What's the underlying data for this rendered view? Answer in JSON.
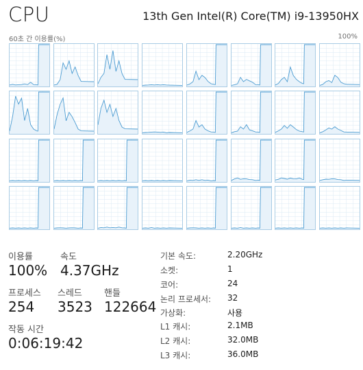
{
  "header": {
    "title": "CPU",
    "cpu_model": "13th Gen Intel(R) Core(TM) i9-13950HX"
  },
  "graph": {
    "y_label": "60초 간 이용률(%)",
    "y_max_label": "100%",
    "line_color": "#4a9bd1",
    "fill_color": "#e8f2fa",
    "border_color": "#a8cbe4",
    "gridline_color": "#dbe9f4",
    "rows": 4,
    "columns": 8,
    "cores": [
      {
        "spike": 1,
        "act": [
          2,
          3,
          2,
          2,
          3,
          4,
          3,
          8,
          3,
          2
        ]
      },
      {
        "spike": 0,
        "act": [
          2,
          3,
          15,
          55,
          40,
          60,
          30,
          45,
          25,
          10
        ]
      },
      {
        "spike": 0,
        "act": [
          5,
          20,
          30,
          75,
          40,
          85,
          35,
          60,
          30,
          15
        ]
      },
      {
        "spike": 0,
        "act": [
          1,
          1,
          2,
          2,
          2,
          2,
          2,
          2,
          2,
          1
        ]
      },
      {
        "spike": 1,
        "act": [
          2,
          4,
          10,
          35,
          15,
          25,
          20,
          10,
          5,
          3
        ]
      },
      {
        "spike": 1,
        "act": [
          1,
          2,
          5,
          20,
          10,
          15,
          12,
          8,
          3,
          2
        ]
      },
      {
        "spike": 1,
        "act": [
          2,
          5,
          15,
          20,
          10,
          45,
          25,
          15,
          10,
          5
        ]
      },
      {
        "spike": 0,
        "act": [
          1,
          3,
          10,
          12,
          8,
          25,
          20,
          8,
          5,
          3
        ]
      },
      {
        "spike": 1,
        "act": [
          5,
          40,
          90,
          70,
          85,
          30,
          60,
          20,
          10,
          5
        ]
      },
      {
        "spike": 0,
        "act": [
          10,
          45,
          70,
          85,
          30,
          50,
          40,
          25,
          10,
          5
        ]
      },
      {
        "spike": 0,
        "act": [
          20,
          60,
          80,
          50,
          70,
          40,
          60,
          30,
          15,
          10
        ]
      },
      {
        "spike": 0,
        "act": [
          1,
          1,
          2,
          2,
          3,
          2,
          2,
          2,
          1,
          1
        ]
      },
      {
        "spike": 1,
        "act": [
          2,
          5,
          10,
          30,
          15,
          20,
          10,
          5,
          3,
          2
        ]
      },
      {
        "spike": 1,
        "act": [
          1,
          3,
          5,
          15,
          10,
          20,
          8,
          5,
          3,
          2
        ]
      },
      {
        "spike": 1,
        "act": [
          2,
          5,
          10,
          18,
          12,
          20,
          15,
          8,
          5,
          3
        ]
      },
      {
        "spike": 0,
        "act": [
          1,
          3,
          8,
          12,
          10,
          15,
          10,
          6,
          3,
          2
        ]
      },
      {
        "spike": 1,
        "act": [
          1,
          1,
          1,
          1,
          1,
          1,
          1,
          1,
          1,
          1
        ]
      },
      {
        "spike": 1,
        "act": [
          1,
          1,
          1,
          1,
          1,
          1,
          1,
          1,
          1,
          1
        ]
      },
      {
        "spike": 1,
        "act": [
          1,
          1,
          1,
          1,
          1,
          1,
          1,
          1,
          1,
          1
        ]
      },
      {
        "spike": 0,
        "act": [
          1,
          1,
          1,
          1,
          1,
          1,
          1,
          1,
          1,
          1
        ]
      },
      {
        "spike": 1,
        "act": [
          1,
          2,
          2,
          3,
          2,
          3,
          2,
          2,
          1,
          1
        ]
      },
      {
        "spike": 1,
        "act": [
          2,
          5,
          8,
          4,
          6,
          5,
          4,
          3,
          2,
          2
        ]
      },
      {
        "spike": 1,
        "act": [
          3,
          4,
          8,
          6,
          5,
          7,
          6,
          5,
          8,
          4
        ]
      },
      {
        "spike": 0,
        "act": [
          2,
          3,
          5,
          4,
          6,
          5,
          4,
          3,
          2,
          2
        ]
      },
      {
        "spike": 1,
        "act": [
          1,
          1,
          1,
          1,
          1,
          1,
          1,
          1,
          1,
          1
        ]
      },
      {
        "spike": 1,
        "act": [
          1,
          1,
          2,
          1,
          1,
          1,
          2,
          1,
          1,
          1
        ]
      },
      {
        "spike": 1,
        "act": [
          1,
          2,
          2,
          3,
          2,
          2,
          2,
          3,
          2,
          1
        ]
      },
      {
        "spike": 0,
        "act": [
          1,
          1,
          1,
          2,
          1,
          1,
          1,
          1,
          1,
          1
        ]
      },
      {
        "spike": 1,
        "act": [
          1,
          1,
          2,
          1,
          1,
          1,
          1,
          1,
          1,
          1
        ]
      },
      {
        "spike": 1,
        "act": [
          1,
          1,
          1,
          2,
          1,
          1,
          1,
          1,
          1,
          1
        ]
      },
      {
        "spike": 1,
        "act": [
          1,
          1,
          1,
          1,
          1,
          1,
          1,
          1,
          1,
          1
        ]
      },
      {
        "spike": 0,
        "act": [
          1,
          1,
          1,
          1,
          1,
          1,
          1,
          1,
          1,
          1
        ]
      }
    ]
  },
  "stats": {
    "utilization_label": "이용률",
    "utilization_value": "100%",
    "speed_label": "속도",
    "speed_value": "4.37GHz",
    "processes_label": "프로세스",
    "processes_value": "254",
    "threads_label": "스레드",
    "threads_value": "3523",
    "handles_label": "핸들",
    "handles_value": "122664",
    "uptime_label": "작동 시간",
    "uptime_value": "0:06:19:42"
  },
  "specs": [
    {
      "label": "기본 속도:",
      "value": "2.20GHz"
    },
    {
      "label": "소켓:",
      "value": "1"
    },
    {
      "label": "코어:",
      "value": "24"
    },
    {
      "label": "논리 프로세서:",
      "value": "32"
    },
    {
      "label": "가상화:",
      "value": "사용"
    },
    {
      "label": "L1 캐시:",
      "value": "2.1MB"
    },
    {
      "label": "L2 캐시:",
      "value": "32.0MB"
    },
    {
      "label": "L3 캐시:",
      "value": "36.0MB"
    }
  ]
}
